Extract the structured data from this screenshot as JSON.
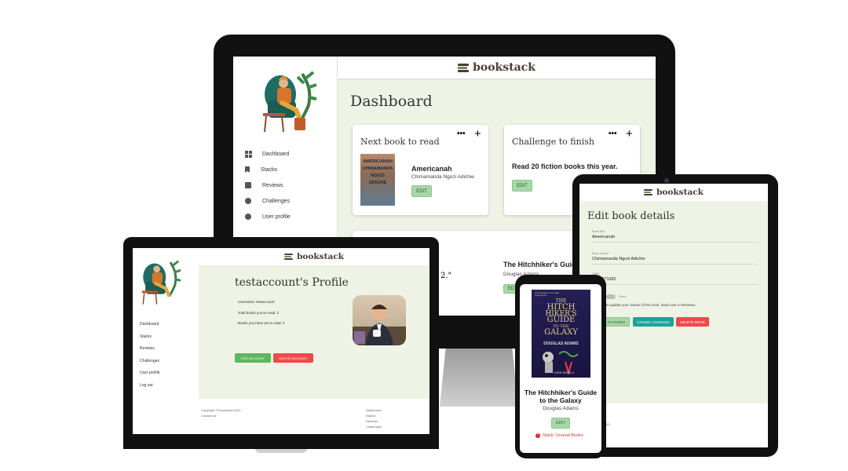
{
  "brand": "bookstack",
  "colors": {
    "page_bg": "#eef3e6",
    "header_bg": "#ffffff",
    "logo_text": "#4b3b34",
    "green_button": "#a6d8a6",
    "red_button": "#ef4a4a",
    "teal_button": "#1aa39a",
    "device_frame": "#111111"
  },
  "desktop": {
    "title": "Dashboard",
    "nav": [
      {
        "label": "Dashboard",
        "icon": "dashboard-icon"
      },
      {
        "label": "Stacks",
        "icon": "bookmark-icon"
      },
      {
        "label": "Reviews",
        "icon": "review-icon"
      },
      {
        "label": "Challenges",
        "icon": "star-badge-icon"
      },
      {
        "label": "User profile",
        "icon": "user-circle-icon"
      }
    ],
    "card_next": {
      "heading": "Next book to read",
      "book_title": "Americanah",
      "book_author": "Chimamanda Ngozi Adichie",
      "button": "EDIT",
      "cover_text": "AMERICANAH CHIMAMANDA NGOZI ADICHIE"
    },
    "card_challenge": {
      "heading": "Challenge to finish",
      "text": "Read 20 fiction books this year.",
      "button": "EDIT"
    },
    "more_icon": "•••",
    "plus_icon": "+",
    "lower_book": {
      "title": "The Hitchhiker's Guide",
      "author": "Douglas Adams",
      "button": "ED"
    },
    "quote_fragment": "2.\""
  },
  "laptop": {
    "profile_title": "testaccount's Profile",
    "username_line": "Username: testaccount",
    "total_read_line": "Total books you've read: 2",
    "yet_to_read_line": "Books you have yet to read: 2",
    "edit_button": "EDIT ACCOUNT",
    "delete_button": "DELETE ACCOUNT",
    "nav": [
      "Dashboard",
      "Stacks",
      "Reviews",
      "Challenges",
      "User profile",
      "Log out"
    ],
    "footer_copyright": "Copyright © Bookstack 2021",
    "footer_contact": "Contact us",
    "footer_links": [
      "Dashboard",
      "Stacks",
      "Reviews",
      "Challenges"
    ]
  },
  "tablet": {
    "title": "Edit book details",
    "fields": [
      {
        "label": "Book title",
        "value": "Americanah"
      },
      {
        "label": "Book author",
        "value": "Chimamanda Ngozi Adichie"
      },
      {
        "label": "ISBN",
        "value": "0307271082"
      }
    ],
    "isbn_visible": "307271082",
    "toggle_label": "Read",
    "note": "e: To update your review of this book, head over to Reviews.",
    "save_button": "CHANGES",
    "cancel_button": "CANCEL CHANGES",
    "delete_button": "DELETE BOOK",
    "footer": "tack 2021"
  },
  "phone": {
    "cover_lines": [
      "THE",
      "HITCH",
      "HIKER'S",
      "GUIDE",
      "TO THE",
      "GALAXY"
    ],
    "cover_author": "DOUGLAS ADAMS",
    "cover_tagline": "The inspiration for the major motion picture",
    "cover_illustrator": "CHRIS RIDDELL",
    "book_title": "The Hitchhiker's Guide to the Galaxy",
    "book_author": "Douglas Adams",
    "button": "EDIT",
    "stack_label": "Stack: Unread Books"
  }
}
